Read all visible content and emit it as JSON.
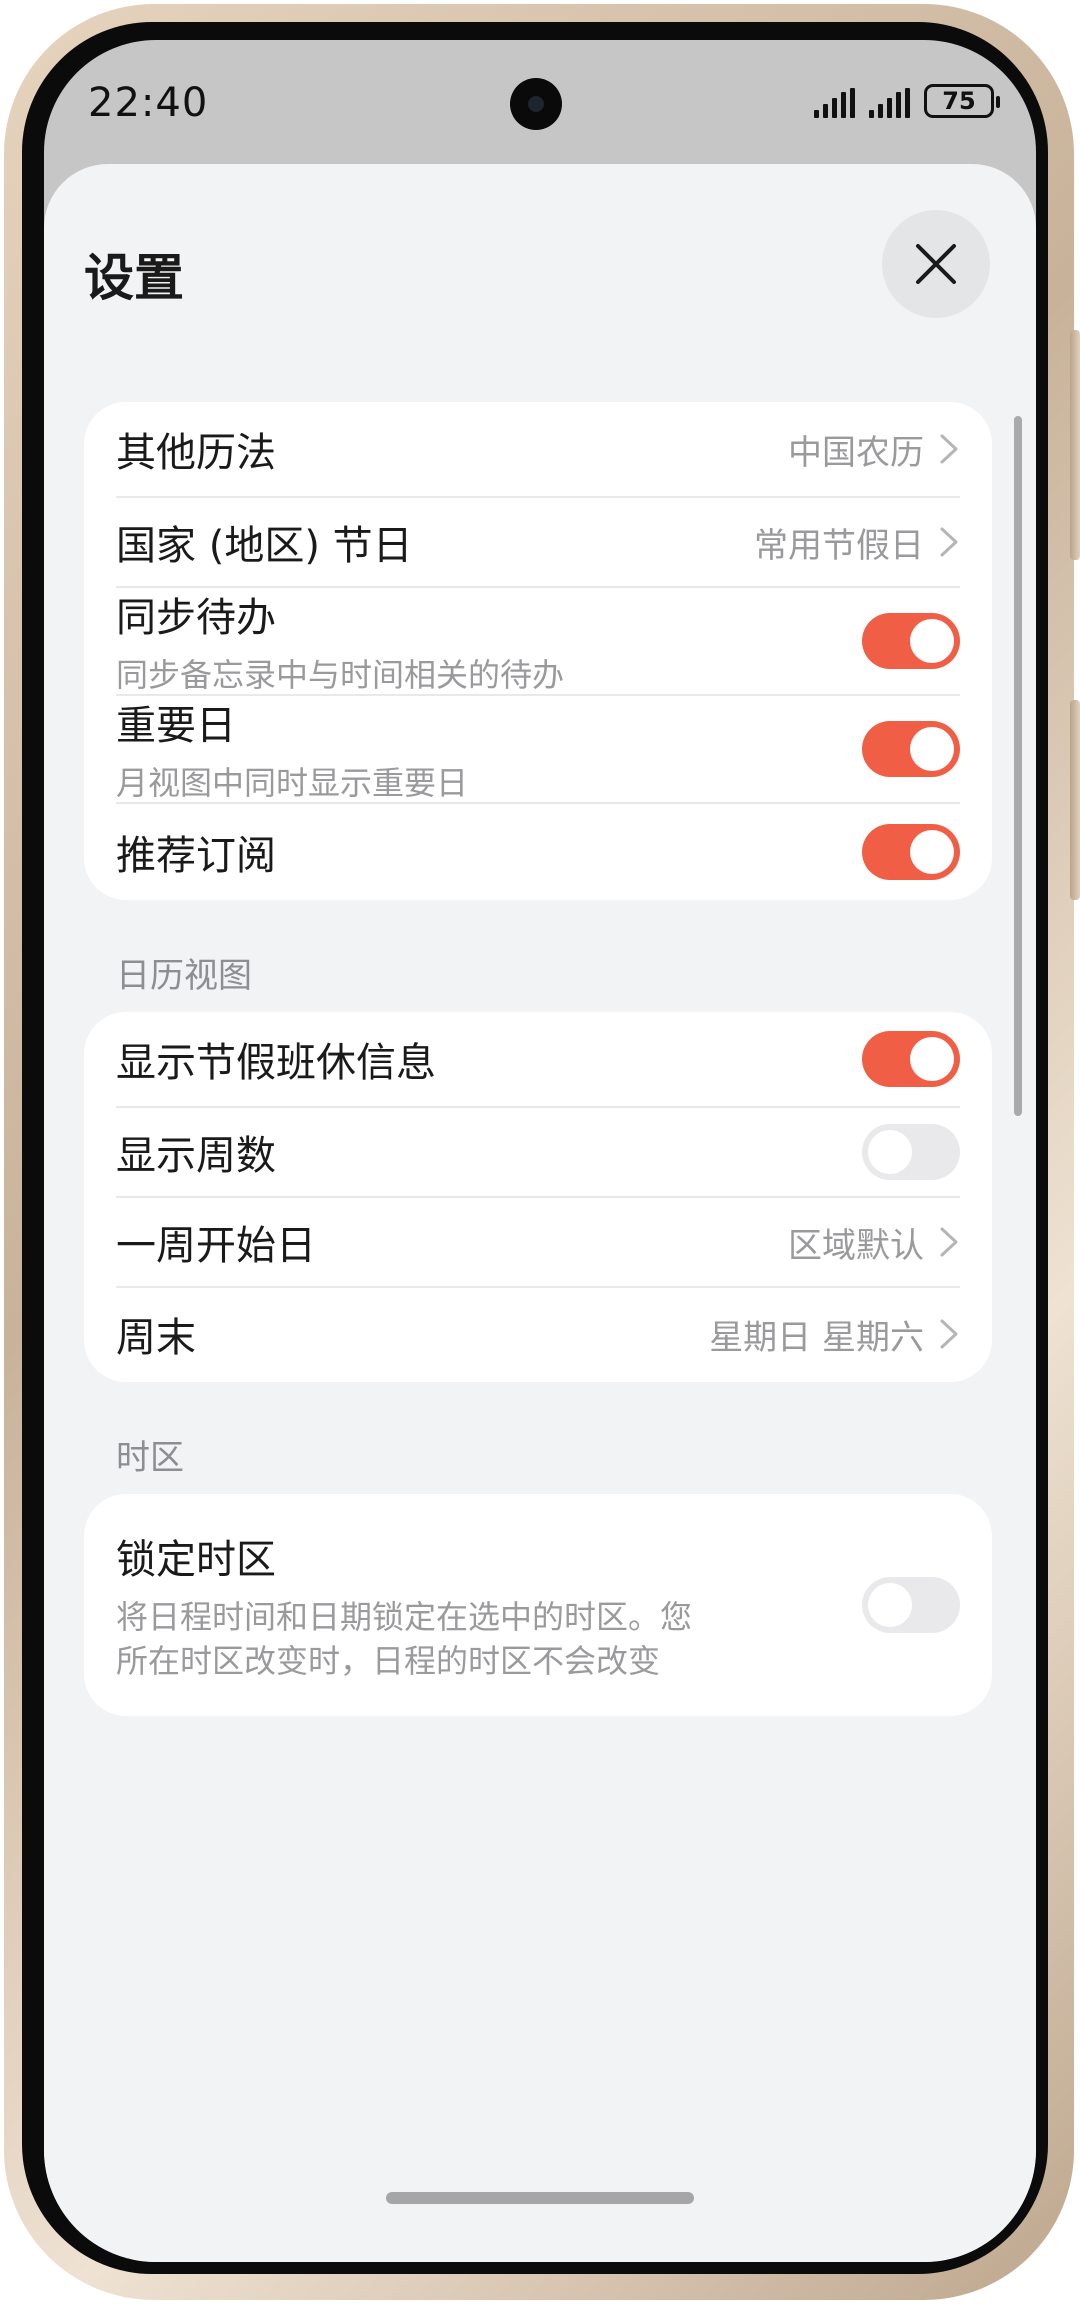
{
  "status_bar": {
    "time": "22:40",
    "battery": "75"
  },
  "header": {
    "title": "设置",
    "close_icon": "close-icon"
  },
  "general": {
    "items": [
      {
        "title": "其他历法",
        "value": "中国农历"
      },
      {
        "title": "国家 (地区) 节日",
        "value": "常用节假日"
      },
      {
        "title": "同步待办",
        "subtitle": "同步备忘录中与时间相关的待办",
        "toggle_on": true
      },
      {
        "title": "重要日",
        "subtitle": "月视图中同时显示重要日",
        "toggle_on": true
      },
      {
        "title": "推荐订阅",
        "toggle_on": true
      }
    ]
  },
  "calendar_view": {
    "label": "日历视图",
    "items": [
      {
        "title": "显示节假班休信息",
        "toggle_on": true
      },
      {
        "title": "显示周数",
        "toggle_on": false
      },
      {
        "title": "一周开始日",
        "value": "区域默认"
      },
      {
        "title": "周末",
        "value": "星期日 星期六"
      }
    ]
  },
  "timezone": {
    "label": "时区",
    "items": [
      {
        "title": "锁定时区",
        "subtitle_line1": "将日程时间和日期锁定在选中的时区。您",
        "subtitle_line2": "所在时区改变时，日程的时区不会改变",
        "toggle_on": false
      }
    ]
  },
  "colors": {
    "accent": "#f05f45",
    "sheet_bg": "#f2f3f5",
    "card_bg": "#ffffff",
    "secondary_text": "#9a9a9d"
  }
}
